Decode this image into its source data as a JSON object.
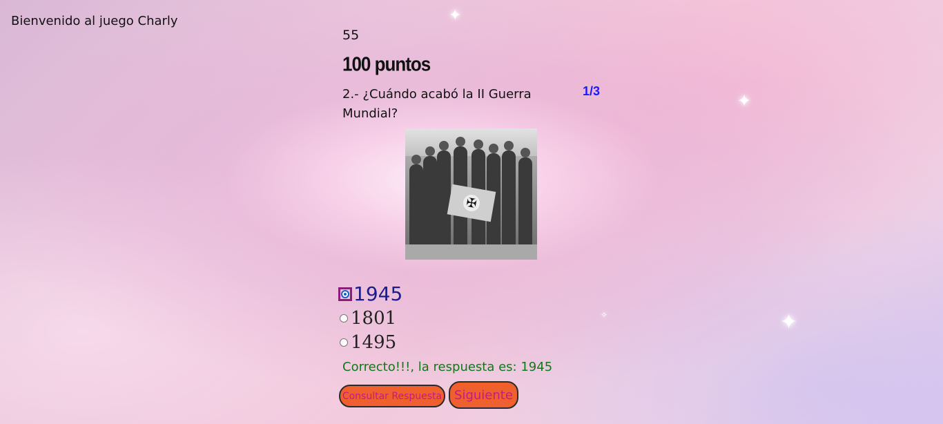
{
  "header": {
    "welcome": "Bienvenido al juego Charly"
  },
  "game": {
    "counter": "55",
    "points": "100 puntos",
    "question": "2.- ¿Cuándo acabó la II Guerra Mundial?",
    "progress": "1/3",
    "image_icon": "photo-soldiers-flag"
  },
  "options": [
    {
      "label": "1945",
      "checked": true
    },
    {
      "label": "1801",
      "checked": false
    },
    {
      "label": "1495",
      "checked": false
    }
  ],
  "feedback": {
    "text": "Correcto!!!, la respuesta es: 1945",
    "color": "#0d7a18"
  },
  "buttons": {
    "consult": "Consultar Respuesta",
    "next": "Siguiente"
  },
  "colors": {
    "progress": "#1a1aff",
    "button_bg": "#f0602e",
    "button_text": "#c21b86"
  }
}
